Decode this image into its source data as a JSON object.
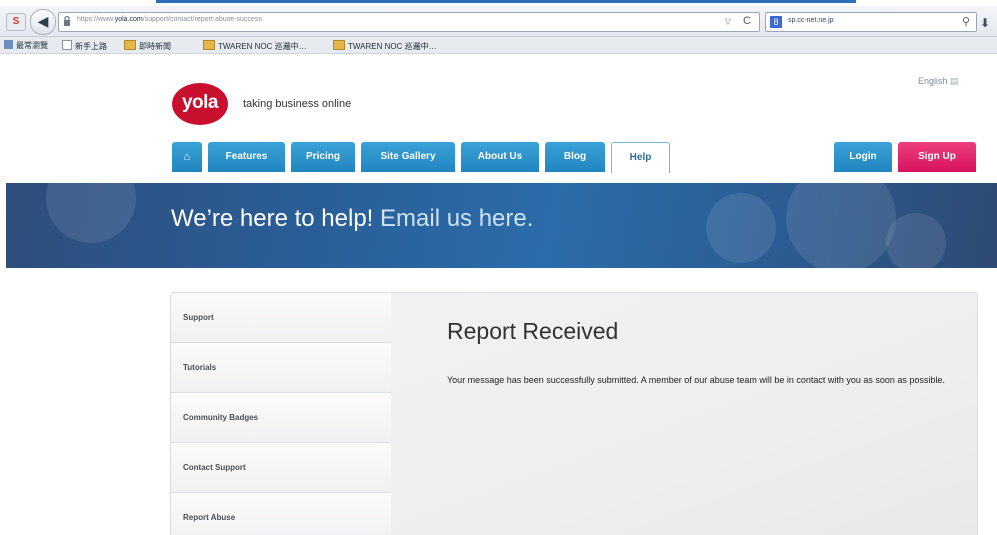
{
  "browser": {
    "url_prefix": "https://www.",
    "url_domain": "yola.com",
    "url_path": "/support/contact/report-abuse-success",
    "search_engine_glyph": "8",
    "search_query": "sp.cc-net.ne.jp",
    "icons": {
      "back": "back-arrow-icon",
      "lock": "lock-icon",
      "reload": "reload-icon",
      "search": "magnifier-icon",
      "download": "download-icon"
    }
  },
  "bookmarks": [
    {
      "label": "最常瀏覽",
      "icon": "page"
    },
    {
      "label": "新手上路",
      "icon": "box"
    },
    {
      "label": "即時新聞",
      "icon": "folder"
    },
    {
      "label": "TWAREN NOC 巡邏中…",
      "icon": "folder"
    },
    {
      "label": "TWAREN NOC 巡邏中…",
      "icon": "folder"
    }
  ],
  "site": {
    "logo_text": "yola",
    "tagline": "taking business online",
    "language": "English",
    "language_glyph": "▤",
    "nav": [
      {
        "label": "",
        "icon": "home-icon"
      },
      {
        "label": "Features"
      },
      {
        "label": "Pricing"
      },
      {
        "label": "Site Gallery"
      },
      {
        "label": "About Us"
      },
      {
        "label": "Blog"
      },
      {
        "label": "Help",
        "active": true
      }
    ],
    "login_label": "Login",
    "signup_label": "Sign Up",
    "colors": {
      "nav_blue": "#2a95cf",
      "signup_pink": "#e5246c",
      "logo_red": "#c8102e"
    }
  },
  "hero": {
    "headline_bold": "We’re here to help!",
    "headline_light": "Email us here."
  },
  "sidebar": {
    "items": [
      "Support",
      "Tutorials",
      "Community Badges",
      "Contact Support",
      "Report Abuse"
    ]
  },
  "main": {
    "title": "Report Received",
    "message": "Your message has been successfully submitted. A member of our abuse team will be in contact with you as soon as possible."
  }
}
